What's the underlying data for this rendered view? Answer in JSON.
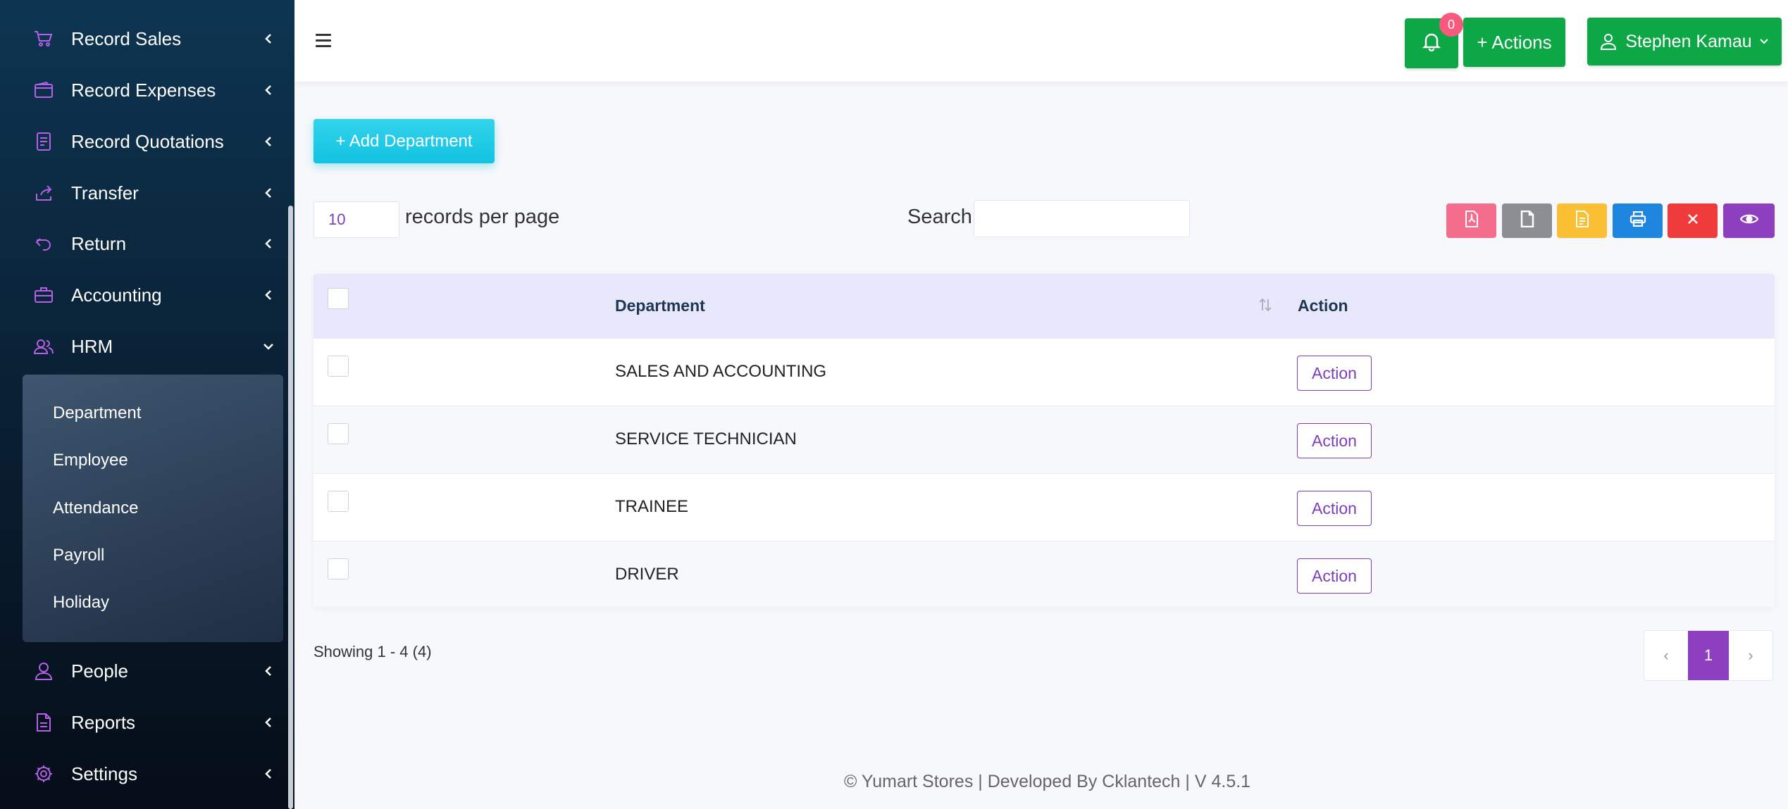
{
  "sidebar": {
    "items": [
      {
        "label": "Record Sales",
        "icon": "cart-icon"
      },
      {
        "label": "Record Expenses",
        "icon": "wallet-icon"
      },
      {
        "label": "Record Quotations",
        "icon": "document-icon"
      },
      {
        "label": "Transfer",
        "icon": "share-icon"
      },
      {
        "label": "Return",
        "icon": "return-icon"
      },
      {
        "label": "Accounting",
        "icon": "briefcase-icon"
      },
      {
        "label": "HRM",
        "icon": "users-icon"
      },
      {
        "label": "People",
        "icon": "user-icon"
      },
      {
        "label": "Reports",
        "icon": "report-icon"
      },
      {
        "label": "Settings",
        "icon": "gear-icon"
      }
    ],
    "hrm_submenu": [
      "Department",
      "Employee",
      "Attendance",
      "Payroll",
      "Holiday"
    ]
  },
  "topbar": {
    "notifications_count": "0",
    "actions_label": "+ Actions",
    "user_name": "Stephen Kamau"
  },
  "content": {
    "add_button": "+ Add Department",
    "per_page_value": "10",
    "per_page_label": "records per page",
    "search_label": "Search",
    "search_value": ""
  },
  "table": {
    "headers": {
      "department": "Department",
      "action": "Action"
    },
    "rows": [
      {
        "department": "SALES AND ACCOUNTING",
        "action": "Action"
      },
      {
        "department": "SERVICE TECHNICIAN",
        "action": "Action"
      },
      {
        "department": "TRAINEE",
        "action": "Action"
      },
      {
        "department": "DRIVER",
        "action": "Action"
      }
    ]
  },
  "pagination": {
    "showing": "Showing 1 - 4 (4)",
    "current_page": "1",
    "prev": "‹",
    "next": "›"
  },
  "toolbar_icons": [
    "pdf-icon",
    "file-icon",
    "excel-icon",
    "print-icon",
    "close-icon",
    "eye-icon"
  ],
  "colors": {
    "sidebar_icon": "#b560e6",
    "green": "#0ea746",
    "cyan": "#12c3e0",
    "purple": "#7c3fb5",
    "pdf": "#f46d8c",
    "file": "#8b8f94",
    "excel": "#fbbf33",
    "print": "#1f86e0",
    "close": "#ef3b3b",
    "eye": "#8d3fbf"
  },
  "footer": "© Yumart Stores | Developed By Cklantech | V 4.5.1"
}
